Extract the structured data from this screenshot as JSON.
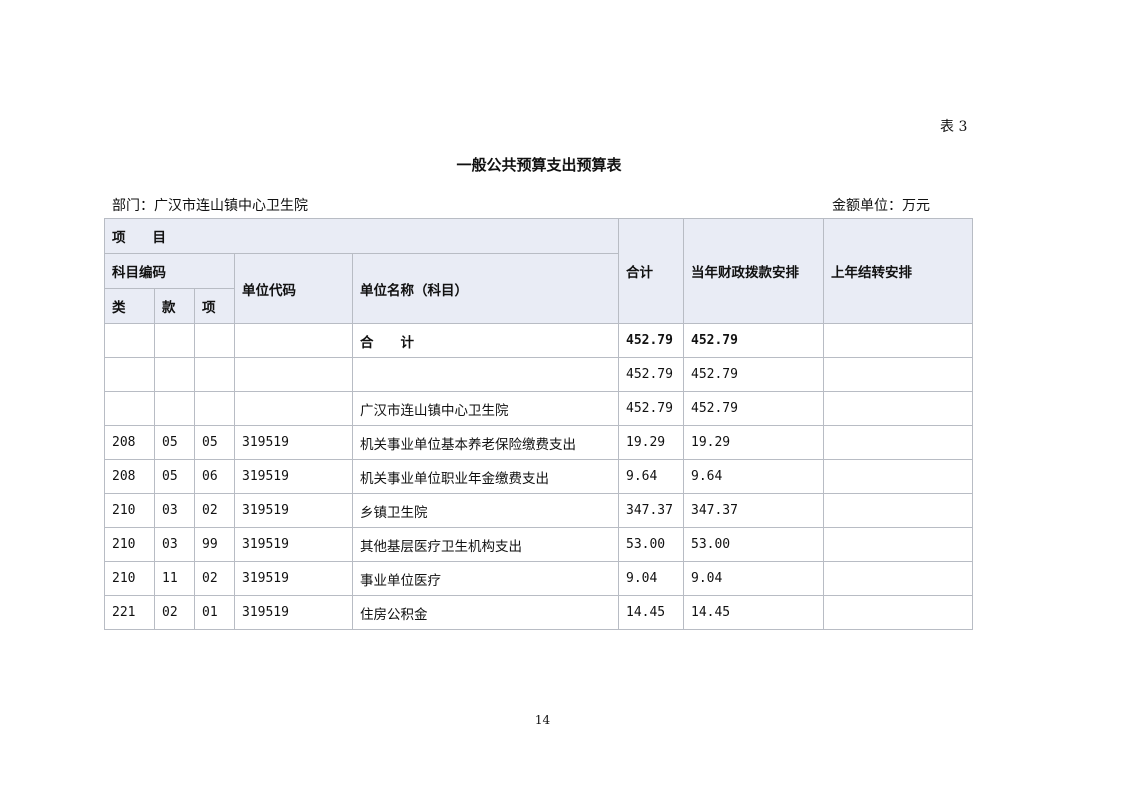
{
  "table_no": "表 3",
  "title": "一般公共预算支出预算表",
  "department": "部门：广汉市连山镇中心卫生院",
  "unit": "金额单位：万元",
  "page_number": "14",
  "header": {
    "item": "项　　目",
    "subject_code": "科目编码",
    "class": "类",
    "section": "款",
    "entry": "项",
    "unit_code": "单位代码",
    "unit_name": "单位名称（科目）",
    "total": "合计",
    "current_year": "当年财政拨款安排",
    "last_year": "上年结转安排"
  },
  "rows": [
    {
      "class": "",
      "section": "",
      "entry": "",
      "unit_code": "",
      "name": "合　　计",
      "total": "452.79",
      "current": "452.79",
      "last": ""
    },
    {
      "class": "",
      "section": "",
      "entry": "",
      "unit_code": "",
      "name": "",
      "total": "452.79",
      "current": "452.79",
      "last": ""
    },
    {
      "class": "",
      "section": "",
      "entry": "",
      "unit_code": "",
      "name": "广汉市连山镇中心卫生院",
      "total": "452.79",
      "current": "452.79",
      "last": ""
    },
    {
      "class": "208",
      "section": "05",
      "entry": "05",
      "unit_code": "319519",
      "name": "机关事业单位基本养老保险缴费支出",
      "total": "19.29",
      "current": "19.29",
      "last": ""
    },
    {
      "class": "208",
      "section": "05",
      "entry": "06",
      "unit_code": "319519",
      "name": "机关事业单位职业年金缴费支出",
      "total": "9.64",
      "current": "9.64",
      "last": ""
    },
    {
      "class": "210",
      "section": "03",
      "entry": "02",
      "unit_code": "319519",
      "name": "乡镇卫生院",
      "total": "347.37",
      "current": "347.37",
      "last": ""
    },
    {
      "class": "210",
      "section": "03",
      "entry": "99",
      "unit_code": "319519",
      "name": "其他基层医疗卫生机构支出",
      "total": "53.00",
      "current": "53.00",
      "last": ""
    },
    {
      "class": "210",
      "section": "11",
      "entry": "02",
      "unit_code": "319519",
      "name": "事业单位医疗",
      "total": "9.04",
      "current": "9.04",
      "last": ""
    },
    {
      "class": "221",
      "section": "02",
      "entry": "01",
      "unit_code": "319519",
      "name": "住房公积金",
      "total": "14.45",
      "current": "14.45",
      "last": ""
    }
  ]
}
